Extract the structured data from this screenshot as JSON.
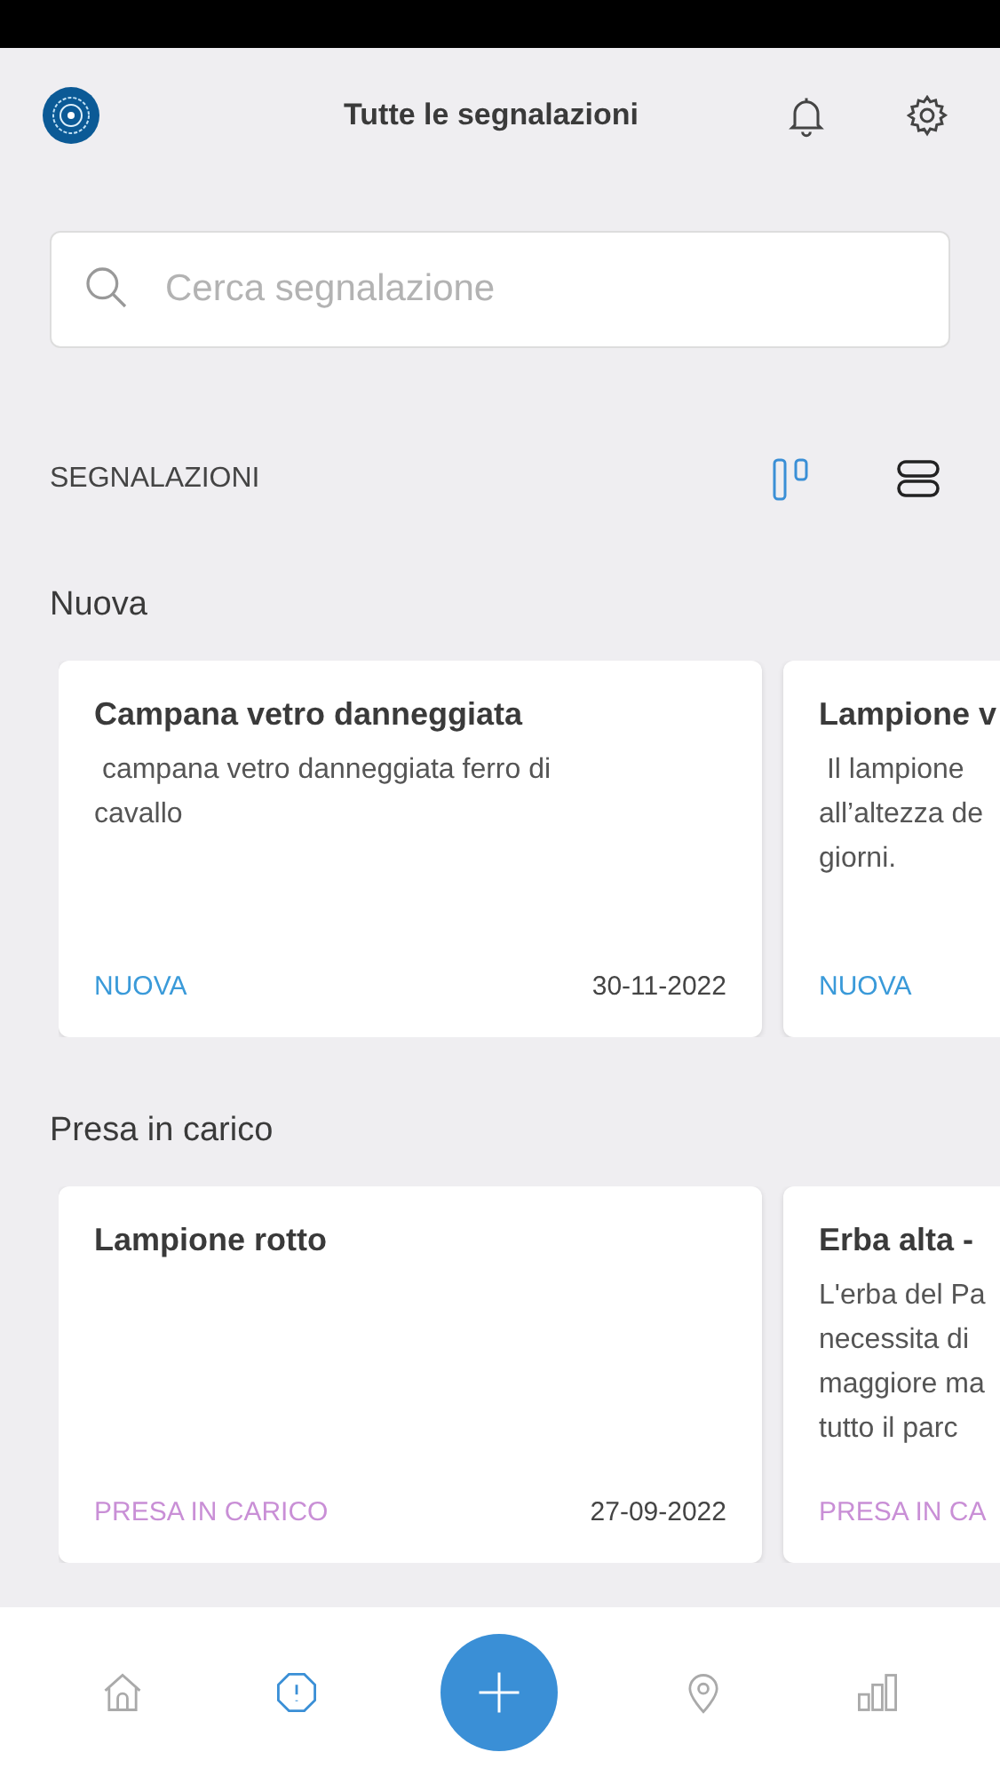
{
  "header": {
    "title": "Tutte le segnalazioni"
  },
  "search": {
    "placeholder": "Cerca segnalazione"
  },
  "section_label": "SEGNALAZIONI",
  "view_toggle": [
    {
      "kind": "board",
      "selected": true
    },
    {
      "kind": "list",
      "selected": false
    }
  ],
  "groups": [
    {
      "title": "Nuova",
      "cards": [
        {
          "title": "Campana vetro danneggiata",
          "description_lines": [
            " campana vetro danneggiata ferro di",
            "cavallo"
          ],
          "status": "NUOVA",
          "color": "#3a9ad9",
          "date": "30-11-2022"
        },
        {
          "title": "Lampione v",
          "description_lines": [
            " Il lampione",
            "all’altezza de",
            "giorni."
          ],
          "status": "NUOVA",
          "color": "#3a9ad9"
        }
      ]
    },
    {
      "title": "Presa in carico",
      "cards": [
        {
          "title": "Lampione rotto",
          "status": "PRESA IN CARICO",
          "color": "#c98fd6",
          "date": "27-09-2022"
        },
        {
          "title": "Erba alta -",
          "description_lines": [
            "L'erba del Pa",
            "necessita di",
            "maggiore ma",
            "tutto il parc"
          ],
          "status": "PRESA IN CA",
          "color": "#c98fd6"
        }
      ]
    }
  ],
  "nav": [
    {
      "kind": "home",
      "selected": false
    },
    {
      "kind": "alert",
      "selected": true
    },
    {
      "kind": "add"
    },
    {
      "kind": "pin",
      "selected": false
    },
    {
      "kind": "stats",
      "selected": false
    }
  ]
}
